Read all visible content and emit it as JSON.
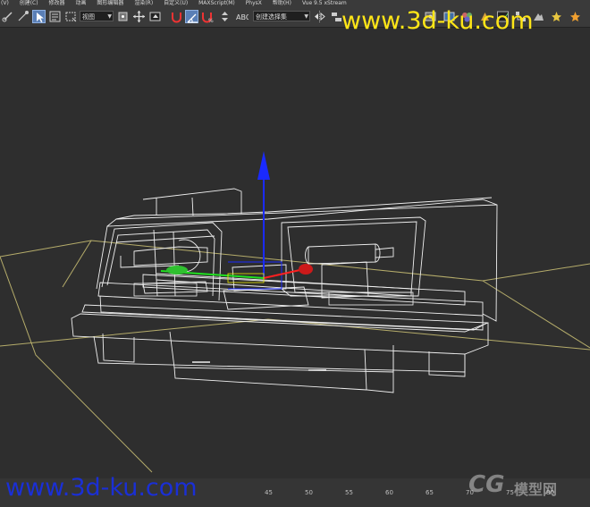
{
  "menu": {
    "items": [
      "(V)",
      "创建(C)",
      "修改器",
      "动画",
      "图形编辑器",
      "渲染(R)",
      "自定义(U)",
      "MAXScript(M)",
      "PhysX",
      "帮助(H)",
      "Vue 9.5 xStream"
    ]
  },
  "toolbar": {
    "view_dropdown": "视图",
    "selection_set_dropdown": "创建选择集"
  },
  "timeline": {
    "ticks": [
      "45",
      "50",
      "55",
      "60",
      "65",
      "70",
      "75",
      "80"
    ]
  },
  "watermarks": {
    "top": "www.3d-ku.com",
    "bottom": "www.3d-ku.com",
    "logo_cg": "CG",
    "logo_site": "模型网"
  },
  "colors": {
    "watermark_top": "#ffe617",
    "watermark_bottom": "#1a2fd6",
    "wireframe": "#f0f0f0",
    "grid": "#d7cc7a",
    "gizmo_z": "#1a2aff",
    "gizmo_x": "#ff2020",
    "gizmo_y": "#20e020"
  }
}
